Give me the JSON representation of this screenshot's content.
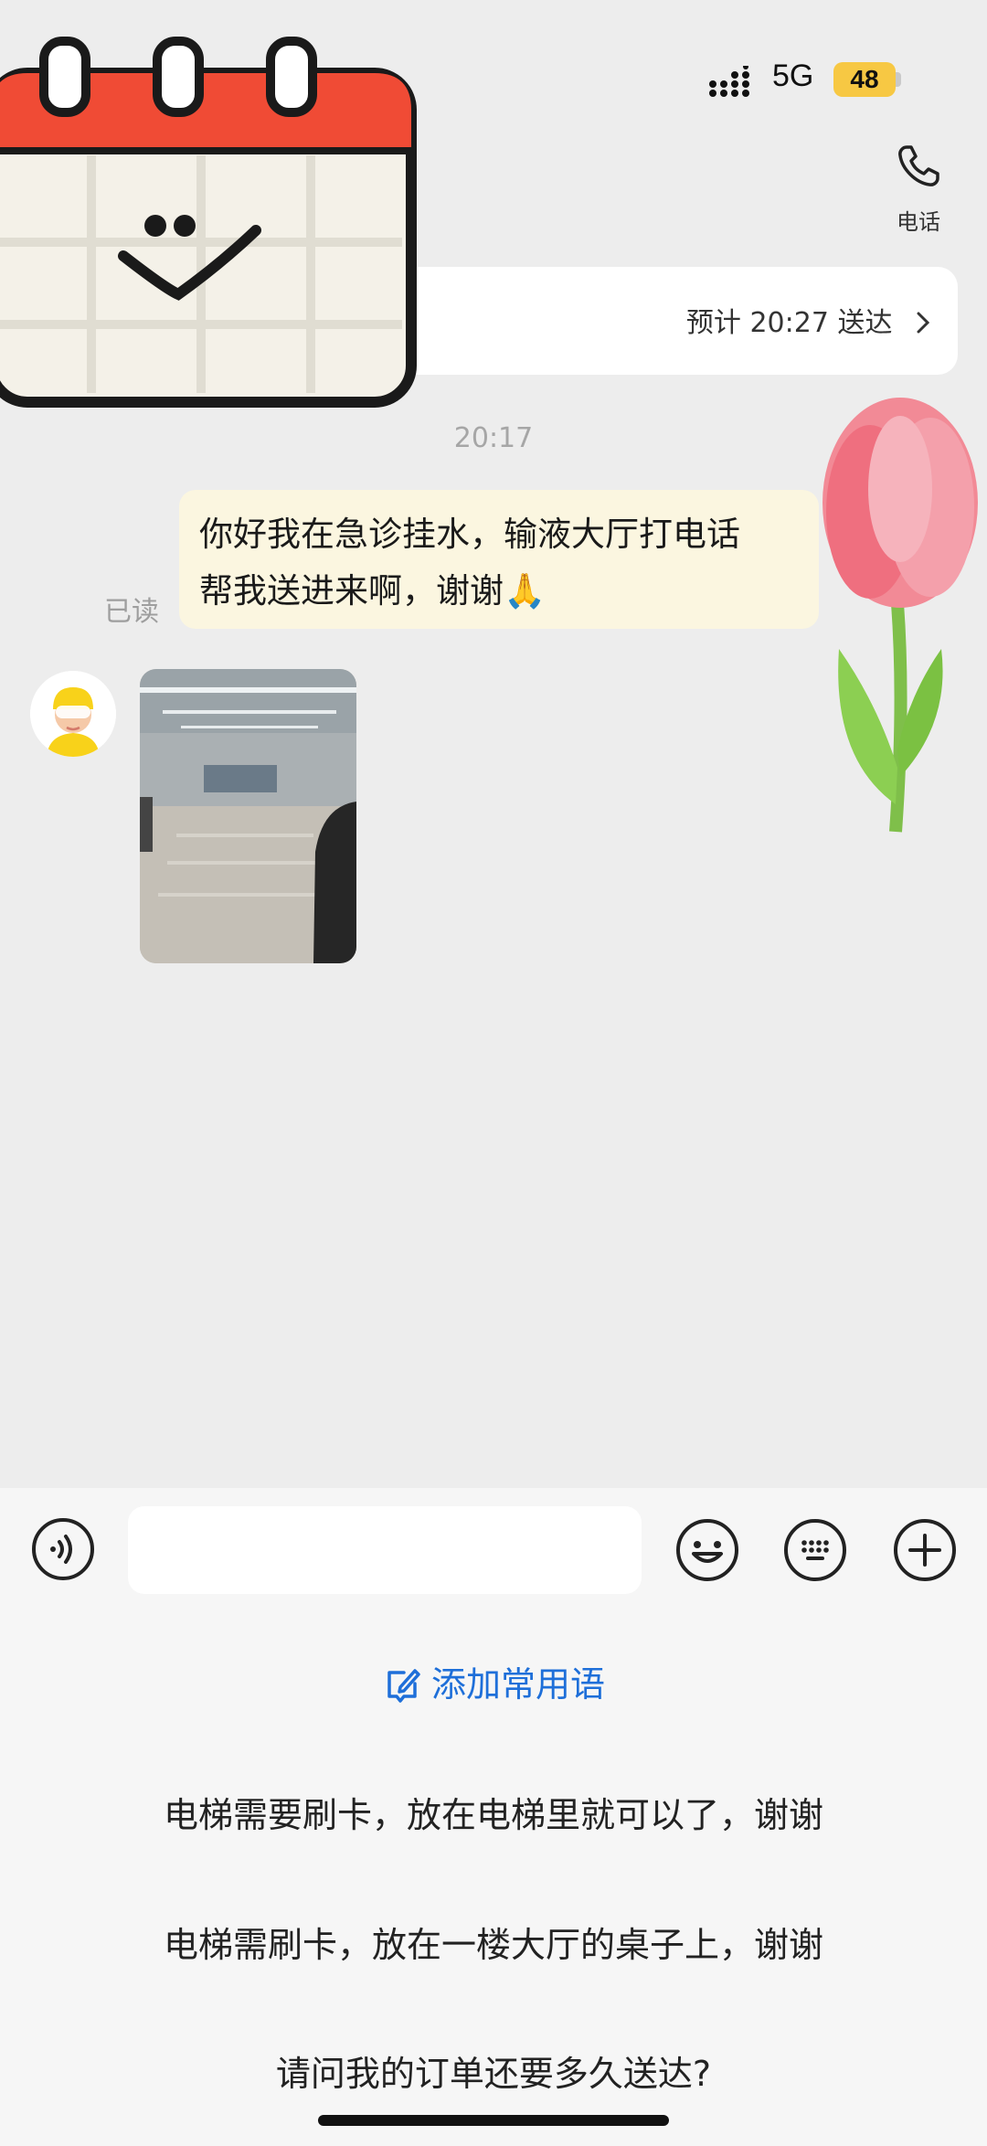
{
  "status_bar": {
    "network": "5G",
    "battery": "48"
  },
  "header": {
    "phone_label": "电话"
  },
  "delivery": {
    "eta": "预计 20:27 送达"
  },
  "chat": {
    "timestamp": "20:17",
    "messages": [
      {
        "direction": "outgoing",
        "text_line1": "你好我在急诊挂水，输液大厅打电话",
        "text_line2": "帮我送进来啊，谢谢🙏",
        "read_status": "已读"
      },
      {
        "direction": "incoming",
        "type": "image"
      }
    ]
  },
  "input": {
    "value": "",
    "placeholder": ""
  },
  "quick_phrases": {
    "add_label": "添加常用语",
    "items": [
      "电梯需要刷卡，放在电梯里就可以了，谢谢",
      "电梯需刷卡，放在一楼大厅的桌子上，谢谢",
      "请问我的订单还要多久送达?"
    ]
  },
  "colors": {
    "accent_blue": "#1e6fd9",
    "battery_yellow": "#f7c843",
    "bubble_out": "#fbf6e0"
  }
}
